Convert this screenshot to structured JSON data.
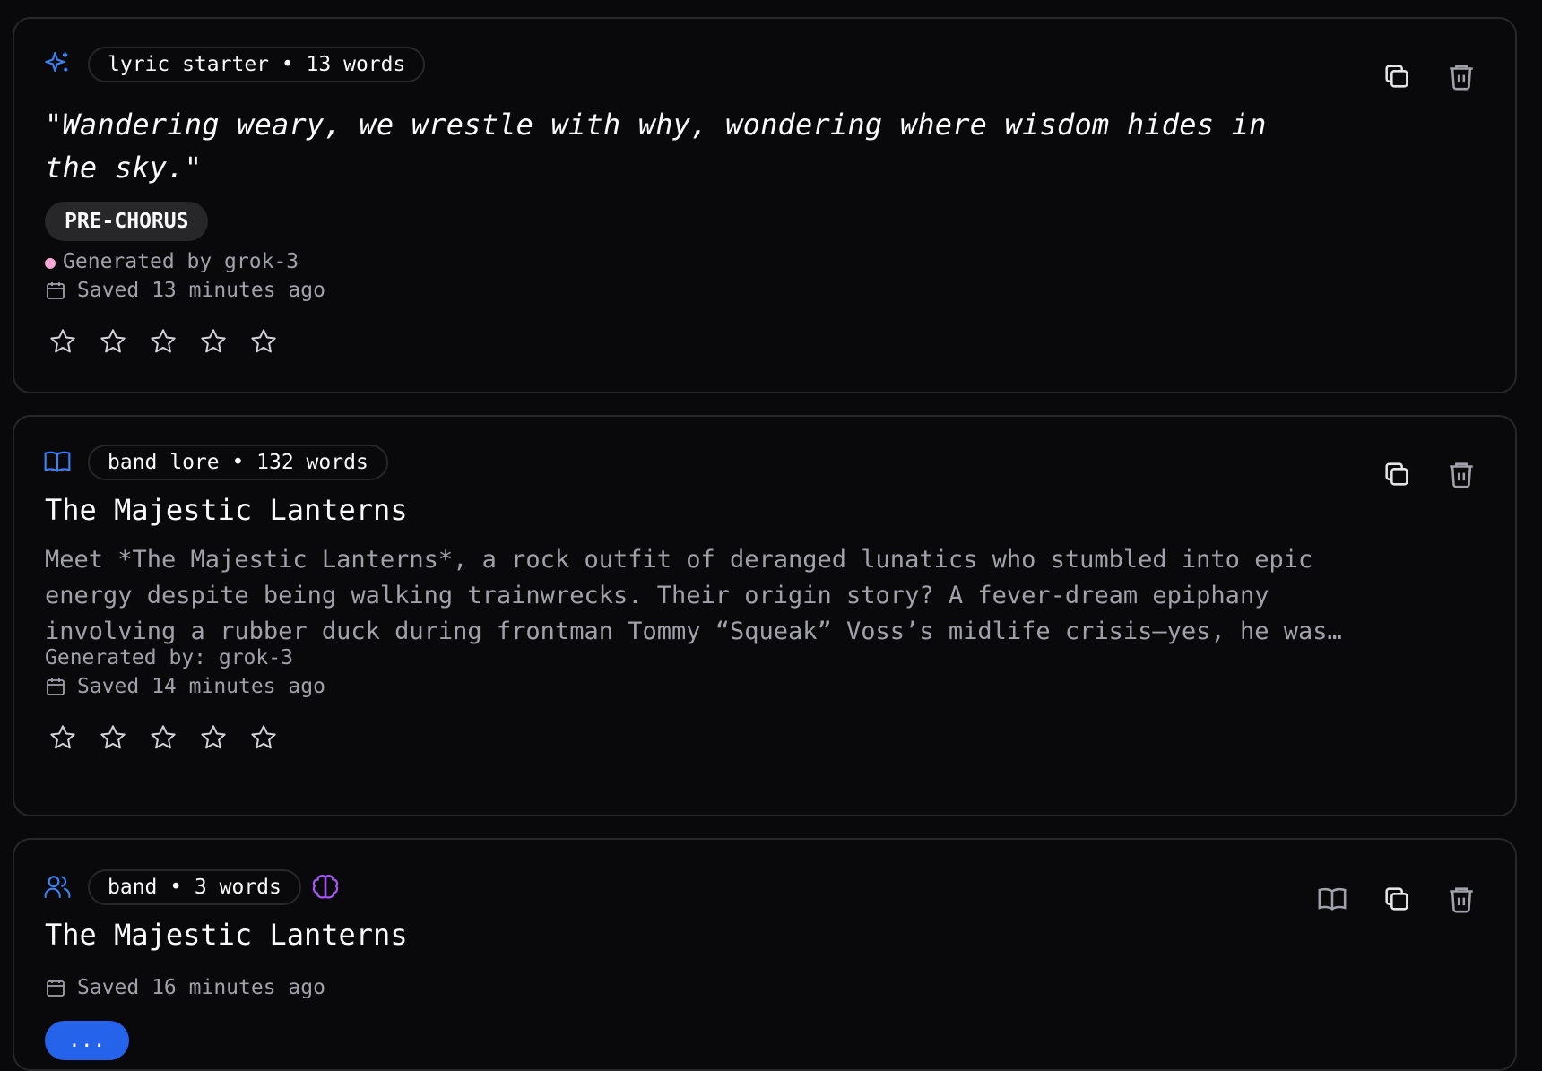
{
  "cards": [
    {
      "type_icon": "sparkles-icon",
      "pill": "lyric starter • 13 words",
      "quote": "\"Wandering weary, we wrestle with why, wondering where wisdom hides in the sky.\"",
      "section_tag": "PRE-CHORUS",
      "generated_by": "Generated by grok-3",
      "saved": "Saved 13 minutes ago",
      "rating": 0,
      "max_rating": 5
    },
    {
      "type_icon": "book-open-icon",
      "pill": "band lore • 132 words",
      "title": "The Majestic Lanterns",
      "body": "Meet *The Majestic Lanterns*, a rock outfit of deranged lunatics who stumbled into epic\nenergy despite being walking trainwrecks. Their origin story? A fever-dream epiphany\ninvolving a rubber duck during frontman Tommy “Squeak” Voss’s midlife crisis—yes, he was…",
      "generated_by": "Generated by: grok-3",
      "saved": "Saved 14 minutes ago",
      "rating": 0,
      "max_rating": 5
    },
    {
      "type_icon": "users-icon",
      "pill": "band • 3 words",
      "title": "The Majestic Lanterns",
      "saved": "Saved 16 minutes ago",
      "button_label": "..."
    }
  ],
  "colors": {
    "accent_blue": "#3b82f6",
    "accent_purple": "#a855f7",
    "border": "#27272a",
    "muted_text": "#a1a1aa"
  }
}
